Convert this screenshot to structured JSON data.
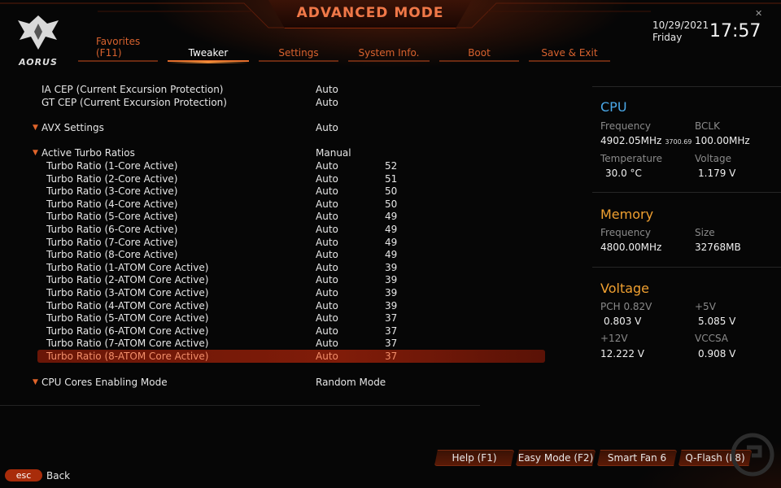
{
  "header": {
    "title": "ADVANCED MODE",
    "logo_text": "AORUS",
    "date": "10/29/2021",
    "day": "Friday",
    "time": "17:57"
  },
  "tabs": [
    {
      "label_line1": "Favorites",
      "label_line2": "(F11)",
      "active": false
    },
    {
      "label_line1": "Tweaker",
      "label_line2": "",
      "active": true
    },
    {
      "label_line1": "Settings",
      "label_line2": "",
      "active": false
    },
    {
      "label_line1": "System Info.",
      "label_line2": "",
      "active": false
    },
    {
      "label_line1": "Boot",
      "label_line2": "",
      "active": false
    },
    {
      "label_line1": "Save & Exit",
      "label_line2": "",
      "active": false
    }
  ],
  "settings": [
    {
      "label": "IA CEP (Current Excursion Protection)",
      "value": "Auto",
      "value2": ""
    },
    {
      "label": "GT CEP (Current Excursion Protection)",
      "value": "Auto",
      "value2": ""
    },
    {
      "label": "AVX Settings",
      "value": "Auto",
      "value2": ""
    },
    {
      "label": "Active Turbo Ratios",
      "value": "Manual",
      "value2": ""
    },
    {
      "label": "Turbo Ratio (1-Core Active)",
      "value": "Auto",
      "value2": "52"
    },
    {
      "label": "Turbo Ratio (2-Core Active)",
      "value": "Auto",
      "value2": "51"
    },
    {
      "label": "Turbo Ratio (3-Core Active)",
      "value": "Auto",
      "value2": "50"
    },
    {
      "label": "Turbo Ratio (4-Core Active)",
      "value": "Auto",
      "value2": "50"
    },
    {
      "label": "Turbo Ratio (5-Core Active)",
      "value": "Auto",
      "value2": "49"
    },
    {
      "label": "Turbo Ratio (6-Core Active)",
      "value": "Auto",
      "value2": "49"
    },
    {
      "label": "Turbo Ratio (7-Core Active)",
      "value": "Auto",
      "value2": "49"
    },
    {
      "label": "Turbo Ratio (8-Core Active)",
      "value": "Auto",
      "value2": "49"
    },
    {
      "label": "Turbo Ratio (1-ATOM Core Active)",
      "value": "Auto",
      "value2": "39"
    },
    {
      "label": "Turbo Ratio (2-ATOM Core Active)",
      "value": "Auto",
      "value2": "39"
    },
    {
      "label": "Turbo Ratio (3-ATOM Core Active)",
      "value": "Auto",
      "value2": "39"
    },
    {
      "label": "Turbo Ratio (4-ATOM Core Active)",
      "value": "Auto",
      "value2": "39"
    },
    {
      "label": "Turbo Ratio (5-ATOM Core Active)",
      "value": "Auto",
      "value2": "37"
    },
    {
      "label": "Turbo Ratio (6-ATOM Core Active)",
      "value": "Auto",
      "value2": "37"
    },
    {
      "label": "Turbo Ratio (7-ATOM Core Active)",
      "value": "Auto",
      "value2": "37"
    },
    {
      "label": "Turbo Ratio (8-ATOM Core Active)",
      "value": "Auto",
      "value2": "37"
    },
    {
      "label": "CPU Cores Enabling Mode",
      "value": "Random Mode",
      "value2": ""
    }
  ],
  "cpu": {
    "title": "CPU",
    "freq_label": "Frequency",
    "freq_value": "4902.05MHz",
    "freq_small": "3700.69",
    "bclk_label": "BCLK",
    "bclk_value": "100.00MHz",
    "temp_label": "Temperature",
    "temp_value": "30.0 °C",
    "volt_label": "Voltage",
    "volt_value": "1.179 V"
  },
  "memory": {
    "title": "Memory",
    "freq_label": "Frequency",
    "freq_value": "4800.00MHz",
    "size_label": "Size",
    "size_value": "32768MB"
  },
  "voltage": {
    "title": "Voltage",
    "pch_label": "PCH 0.82V",
    "pch_value": "0.803 V",
    "v5_label": "+5V",
    "v5_value": "5.085 V",
    "v12_label": "+12V",
    "v12_value": "12.222 V",
    "vccsa_label": "VCCSA",
    "vccsa_value": "0.908 V"
  },
  "footer": {
    "help": "Help (F1)",
    "easy": "Easy Mode (F2)",
    "smartfan": "Smart Fan 6 (F6)",
    "qflash": "Q-Flash (F8)",
    "esc": "esc",
    "back": "Back"
  },
  "colors": {
    "accent": "#e0642a",
    "selected_row": "#801c09",
    "accent_text": "#f28e6a",
    "title_text": "#f07848",
    "panel_title": "#f0a030"
  }
}
